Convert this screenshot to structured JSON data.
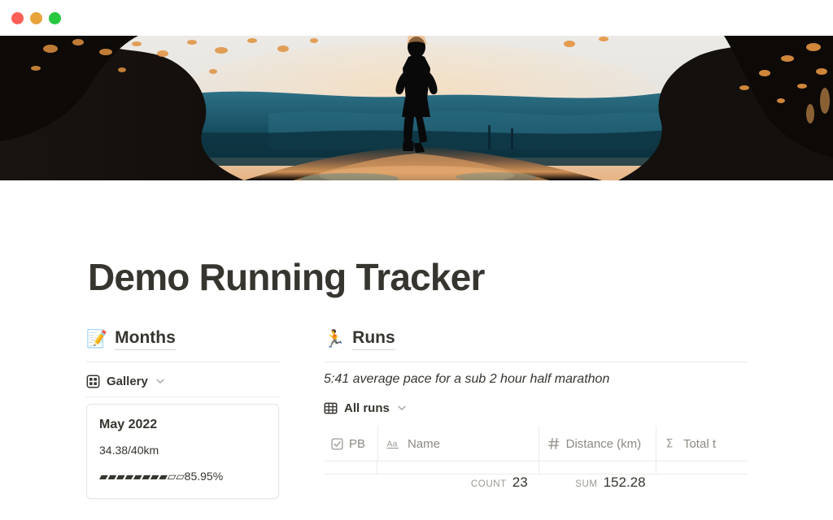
{
  "window": {
    "traffic_lights": [
      {
        "name": "close",
        "color": "#ff5f57"
      },
      {
        "name": "minimize",
        "color": "#e8a33d"
      },
      {
        "name": "zoom",
        "color": "#28c840"
      }
    ]
  },
  "cover": {
    "alt": "Runner silhouetted on a path at sunset",
    "page_icon": "👟",
    "page_icon_name": "running-shoe-emoji",
    "palette": {
      "sky": "#e9e7e3",
      "sky_warm": "#e8b07a",
      "hill_far": "#2a6d82",
      "hill_near": "#0e3a49",
      "foliage": "#14100e",
      "path": "#c98a52",
      "highlight": "#f0a košt"
    }
  },
  "page": {
    "title": "Demo Running Tracker"
  },
  "left_column": {
    "database": {
      "emoji": "📝",
      "emoji_name": "memo-emoji",
      "name": "Months"
    },
    "view": {
      "icon": "gallery-icon",
      "label": "Gallery",
      "chevron": "chevron-down-icon"
    },
    "cards": [
      {
        "title": "May 2022",
        "subtitle": "34.38/40km",
        "progress_bar": "▰▰▰▰▰▰▰▰▱▱",
        "progress_pct": "85.95%"
      }
    ]
  },
  "right_column": {
    "database": {
      "emoji": "🏃",
      "emoji_name": "runner-emoji",
      "name": "Runs"
    },
    "description": "5:41 average pace for a sub 2 hour half marathon",
    "view": {
      "icon": "table-icon",
      "label": "All runs",
      "chevron": "chevron-down-icon"
    },
    "table": {
      "columns": [
        {
          "icon": "checkbox-icon",
          "label": "PB"
        },
        {
          "icon": "text-aa-icon",
          "label": "Name"
        },
        {
          "icon": "number-hash-icon",
          "label": "Distance (km)"
        },
        {
          "icon": "formula-sigma-icon",
          "label": "Total t"
        }
      ],
      "aggregations": [
        {
          "column": "Name",
          "label": "COUNT",
          "value": "23"
        },
        {
          "column": "Distance (km)",
          "label": "SUM",
          "value": "152.28"
        }
      ]
    }
  }
}
